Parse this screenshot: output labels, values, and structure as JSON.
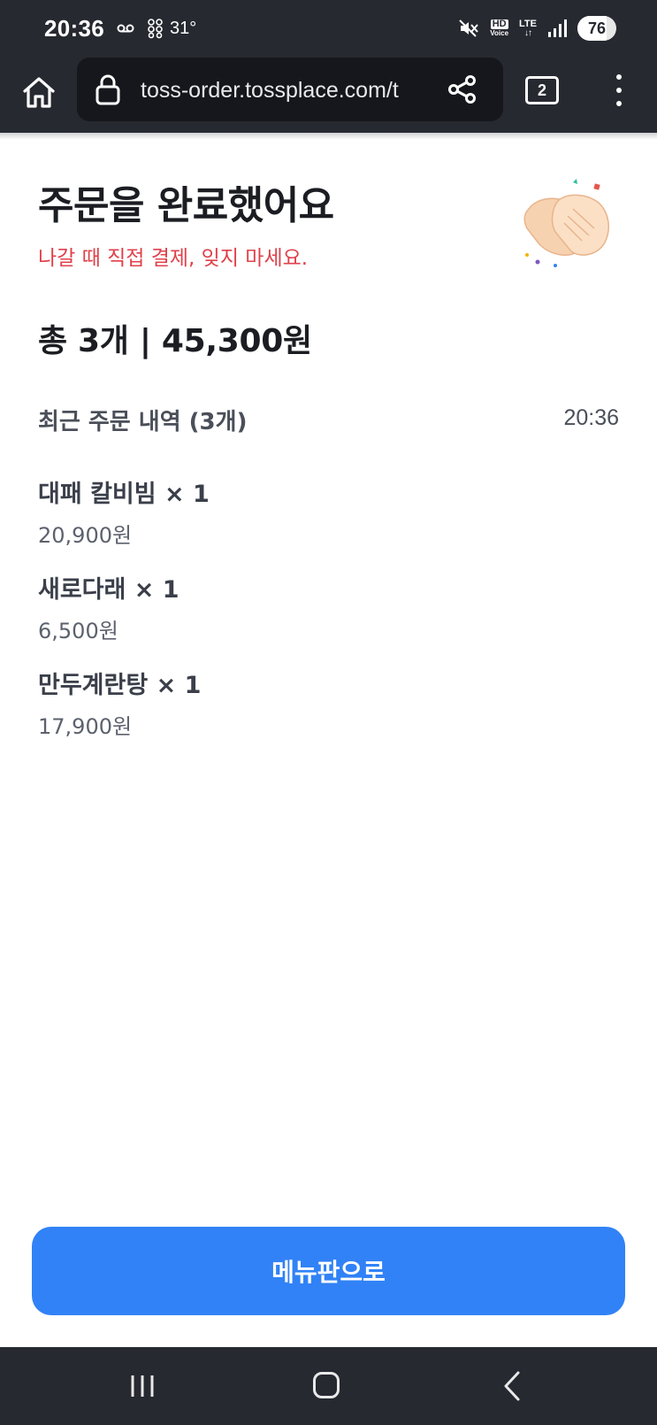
{
  "status_bar": {
    "time": "20:36",
    "temperature": "31°",
    "battery": "76",
    "battery_level_percent": 76,
    "icons": [
      "voicemail-icon",
      "weather-icon",
      "mute-icon",
      "hd-voice-icon",
      "lte-icon",
      "signal-icon",
      "battery-icon"
    ],
    "hd": "HD",
    "voice": "Voice",
    "lte": "LTE",
    "lte_arrows": "↓↑"
  },
  "browser": {
    "url": "toss-order.tossplace.com/t",
    "tab_count": "2",
    "icons": [
      "home-icon",
      "lock-icon",
      "share-icon",
      "tabs-icon",
      "more-vert-icon"
    ]
  },
  "order": {
    "title": "주문을 완료했어요",
    "subtitle": "나갈 때 직접 결제, 잊지 마세요.",
    "total": "총 3개 | 45,300원",
    "recent_header": "최근 주문 내역 (3개)",
    "recent_time": "20:36",
    "items": [
      {
        "name": "대패 칼비빔 × 1",
        "price": "20,900원"
      },
      {
        "name": "새로다래 × 1",
        "price": "6,500원"
      },
      {
        "name": "만두계란탕 × 1",
        "price": "17,900원"
      }
    ],
    "menu_button": "메뉴판으로"
  },
  "colors": {
    "accent": "#3182f6",
    "warning_text": "#e0414b",
    "system_bar": "#262930"
  }
}
